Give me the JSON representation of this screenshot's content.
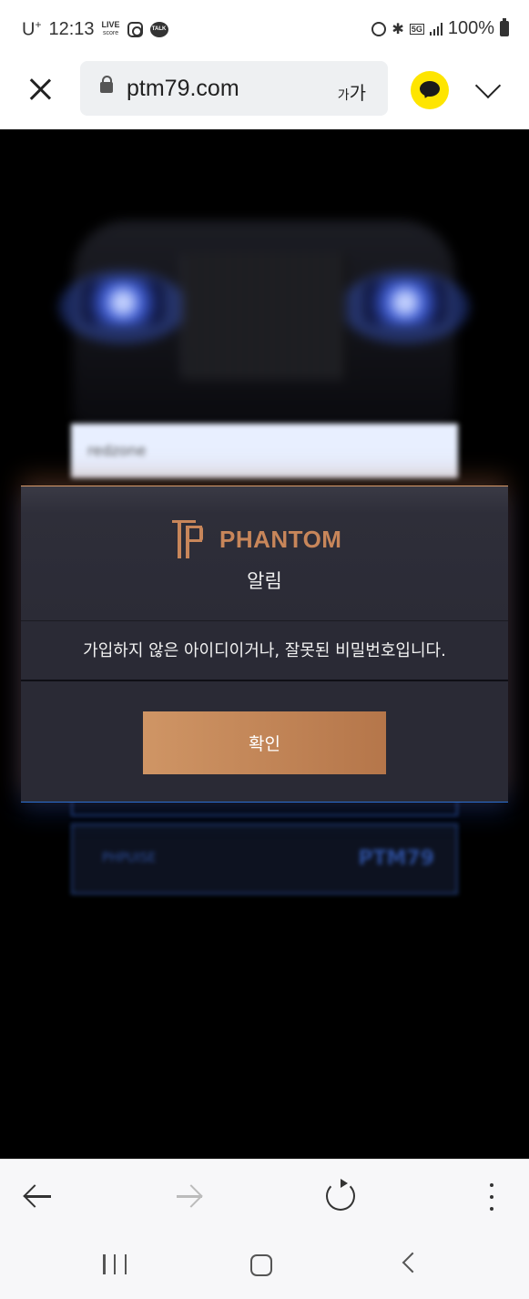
{
  "status_bar": {
    "carrier": "U",
    "carrier_sup": "+",
    "time": "12:13",
    "live_badge_top": "LIVE",
    "live_badge_bottom": "score",
    "talk_badge": "TALK",
    "network_badge": "5G",
    "battery_text": "100%"
  },
  "browser": {
    "url": "ptm79.com",
    "text_size_small": "가",
    "text_size_large": "가"
  },
  "background": {
    "input_value": "redzone",
    "box_left_text": "PHPUISE",
    "box_right_text": "PTM79"
  },
  "modal": {
    "brand": "PHANTOM",
    "title": "알림",
    "message": "가입하지 않은 아이디이거나, 잘못된 비밀번호입니다.",
    "confirm_label": "확인",
    "colors": {
      "accent": "#c8865a",
      "panel": "#2a2a35",
      "button_start": "#cf9565",
      "button_end": "#b5764a"
    }
  },
  "icons": {
    "close": "close-icon",
    "lock": "lock-icon",
    "kakao": "kakaotalk-icon",
    "chevron": "chevron-down-icon",
    "back": "arrow-left-icon",
    "forward": "arrow-right-icon",
    "reload": "reload-icon",
    "more": "more-vertical-icon"
  }
}
